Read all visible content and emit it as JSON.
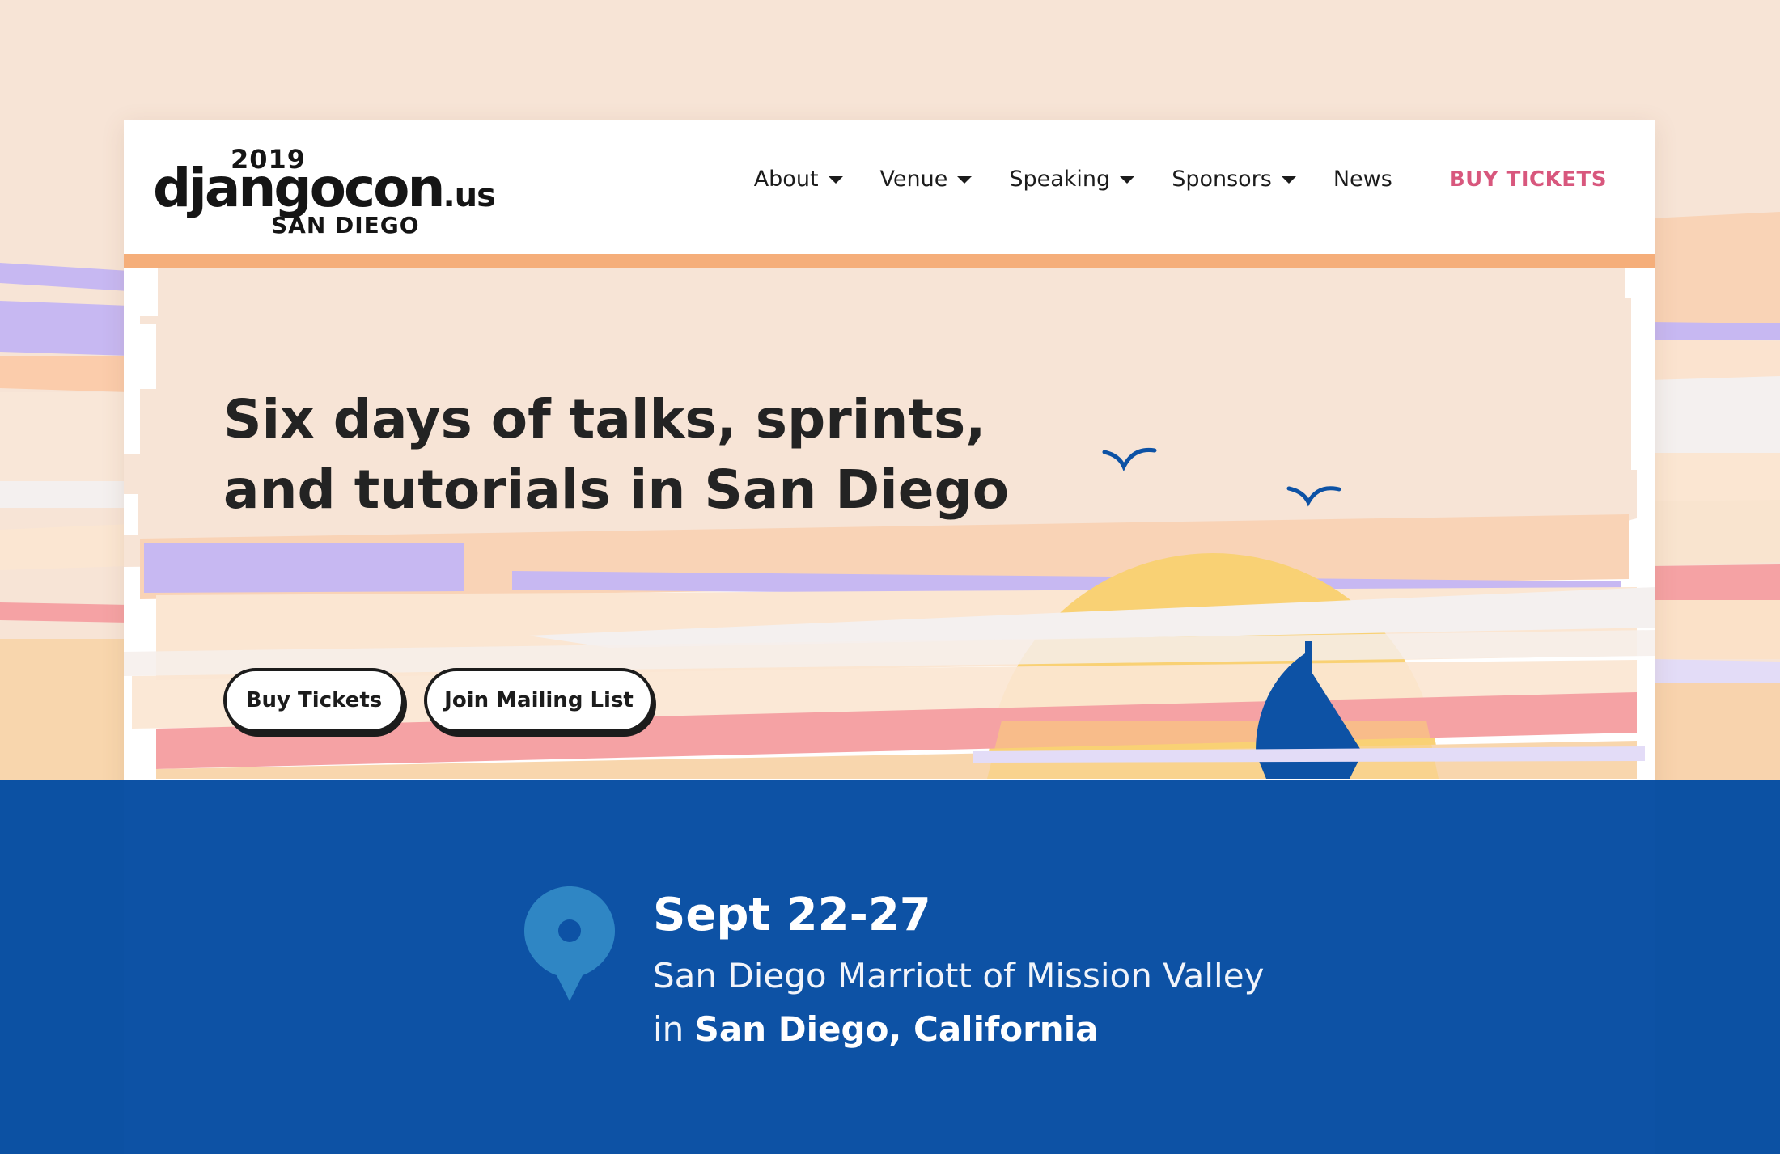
{
  "logo": {
    "year": "2019",
    "name": "djangocon",
    "suffix": ".us",
    "city": "SAN DIEGO"
  },
  "nav": {
    "items": [
      {
        "label": "About",
        "dropdown": true
      },
      {
        "label": "Venue",
        "dropdown": true
      },
      {
        "label": "Speaking",
        "dropdown": true
      },
      {
        "label": "Sponsors",
        "dropdown": true
      },
      {
        "label": "News",
        "dropdown": false
      }
    ],
    "cta": "BUY TICKETS"
  },
  "hero": {
    "title_line1": "Six days of talks, sprints,",
    "title_line2": "and tutorials in San Diego",
    "buttons": [
      "Buy Tickets",
      "Join Mailing List"
    ]
  },
  "info": {
    "dates": "Sept 22-27",
    "venue": "San Diego Marriott of Mission Valley",
    "city_prefix": "in",
    "city": "San Diego, California"
  },
  "colors": {
    "accent": "#d8577d",
    "brand_blue": "#0c51a3",
    "header_bar": "#f5ae7a",
    "sun": "#f9d174",
    "pin": "#2f86c4"
  },
  "icons": {
    "pin": "map-pin-icon",
    "caret": "chevron-down-icon",
    "birds": "seagull-icon",
    "boat": "sailboat-icon"
  }
}
